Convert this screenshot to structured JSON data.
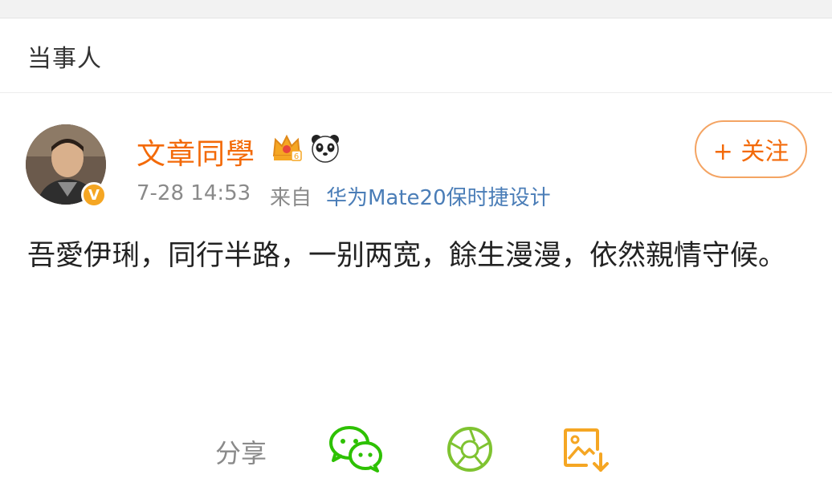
{
  "header": {
    "title": "当事人"
  },
  "post": {
    "username": "文章同學",
    "badges": [
      "vip-crown-icon",
      "panda-icon"
    ],
    "verified_label": "V",
    "time": "7-28 14:53",
    "from_label": "来自",
    "device": "华为Mate20保时捷设计",
    "follow_label": "+ 关注",
    "text": "吾愛伊琍，同行半路，一别两宽，餘生漫漫，依然親情守候。"
  },
  "share": {
    "label": "分享",
    "targets": [
      "wechat-icon",
      "moments-icon",
      "save-image-icon"
    ]
  },
  "colors": {
    "accent": "#f36a09",
    "link": "#4a7db7",
    "wechat": "#2dc100",
    "moments": "#7fc331",
    "save": "#f5a623"
  }
}
